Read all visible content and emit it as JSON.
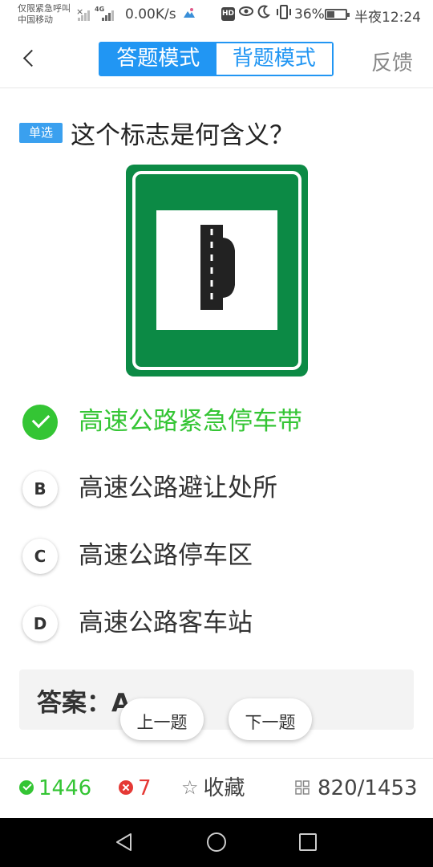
{
  "status_bar": {
    "emergency_text": "仅限紧急呼叫",
    "carrier": "中国移动",
    "net_type": "4G",
    "speed": "0.00K/s",
    "hd_badge": "HD",
    "battery_percent": "36%",
    "battery_level": 0.36,
    "time": "半夜12:24"
  },
  "header": {
    "modes": [
      {
        "label": "答题模式",
        "active": true
      },
      {
        "label": "背题模式",
        "active": false
      }
    ],
    "feedback_label": "反馈"
  },
  "question": {
    "type_badge": "单选",
    "text": "这个标志是何含义？",
    "sign": {
      "border_color": "#0c8a45",
      "panel_color": "#ffffff",
      "road_color": "#222222"
    },
    "options": [
      {
        "letter": "A",
        "text": "高速公路紧急停车带",
        "state": "correct"
      },
      {
        "letter": "B",
        "text": "高速公路避让处所",
        "state": "normal"
      },
      {
        "letter": "C",
        "text": "高速公路停车区",
        "state": "normal"
      },
      {
        "letter": "D",
        "text": "高速公路客车站",
        "state": "normal"
      }
    ]
  },
  "answer": {
    "text": "答案：A"
  },
  "nav_buttons": {
    "prev_label": "上一题",
    "next_label": "下一题"
  },
  "toolbar": {
    "correct_count": "1446",
    "wrong_count": "7",
    "favorite_label": "收藏",
    "progress": "820/1453"
  },
  "colors": {
    "accent_blue": "#2196f3",
    "correct_green": "#34c534",
    "wrong_red": "#e53935"
  }
}
